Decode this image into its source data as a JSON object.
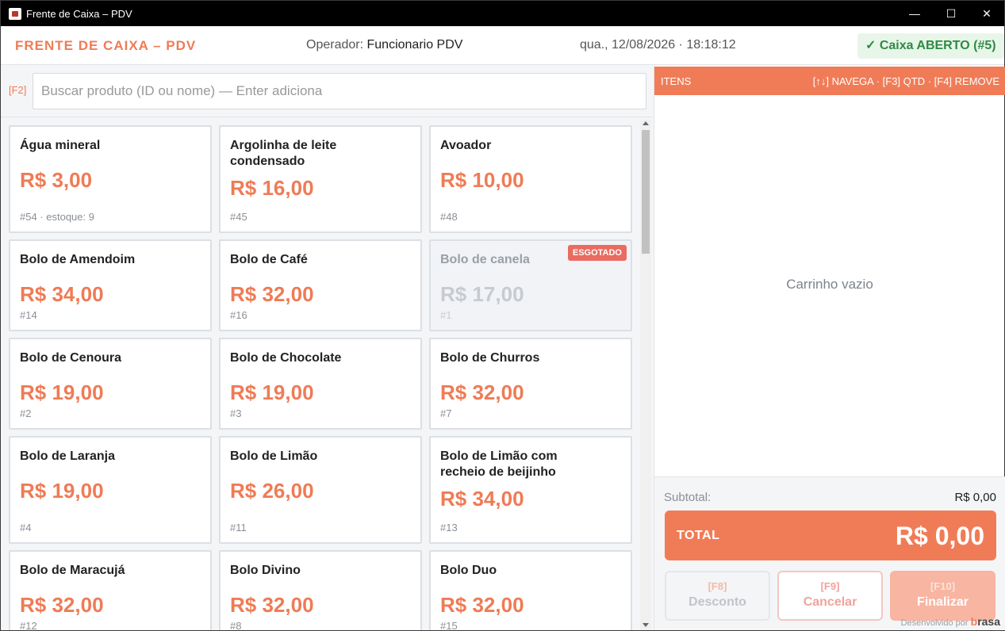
{
  "window": {
    "title": "Frente de Caixa – PDV",
    "controls": {
      "minimize": "—",
      "maximize": "☐",
      "close": "✕"
    }
  },
  "header": {
    "brand": "FRENTE DE CAIXA – PDV",
    "operator_label": "Operador:",
    "operator_name": "Funcionario PDV",
    "datetime": "qua., 12/08/2026 · 18:18:12",
    "status": "✓ Caixa ABERTO (#5)"
  },
  "search": {
    "hotkey": "[F2]",
    "placeholder": "Buscar produto (ID ou nome) — Enter adiciona",
    "value": ""
  },
  "products": [
    {
      "name": "Água mineral",
      "price": "R$ 3,00",
      "meta": "#54 · estoque: 9",
      "sold_out": false
    },
    {
      "name": "Argolinha de leite condensado",
      "price": "R$ 16,00",
      "meta": "#45",
      "sold_out": false
    },
    {
      "name": "Avoador",
      "price": "R$ 10,00",
      "meta": "#48",
      "sold_out": false
    },
    {
      "name": "Bolo de Amendoim",
      "price": "R$ 34,00",
      "meta": "#14",
      "sold_out": false
    },
    {
      "name": "Bolo de Café",
      "price": "R$ 32,00",
      "meta": "#16",
      "sold_out": false
    },
    {
      "name": "Bolo de canela",
      "price": "R$ 17,00",
      "meta": "#1",
      "sold_out": true,
      "badge": "ESGOTADO"
    },
    {
      "name": "Bolo de Cenoura",
      "price": "R$ 19,00",
      "meta": "#2",
      "sold_out": false
    },
    {
      "name": "Bolo de Chocolate",
      "price": "R$ 19,00",
      "meta": "#3",
      "sold_out": false
    },
    {
      "name": "Bolo de Churros",
      "price": "R$ 32,00",
      "meta": "#7",
      "sold_out": false
    },
    {
      "name": "Bolo de Laranja",
      "price": "R$ 19,00",
      "meta": "#4",
      "sold_out": false
    },
    {
      "name": "Bolo de Limão",
      "price": "R$ 26,00",
      "meta": "#11",
      "sold_out": false
    },
    {
      "name": "Bolo de Limão com recheio de beijinho",
      "price": "R$ 34,00",
      "meta": "#13",
      "sold_out": false
    },
    {
      "name": "Bolo de Maracujá",
      "price": "R$ 32,00",
      "meta": "#12",
      "sold_out": false
    },
    {
      "name": "Bolo Divino",
      "price": "R$ 32,00",
      "meta": "#8",
      "sold_out": false
    },
    {
      "name": "Bolo Duo",
      "price": "R$ 32,00",
      "meta": "#15",
      "sold_out": false
    }
  ],
  "cart": {
    "title": "ITENS",
    "hint": "[↑↓] NAVEGA · [F3] QTD · [F4] REMOVE",
    "empty_text": "Carrinho vazio",
    "subtotal_label": "Subtotal:",
    "subtotal_value": "R$ 0,00",
    "total_label": "TOTAL",
    "total_value": "R$ 0,00"
  },
  "actions": {
    "discount": {
      "key": "[F8]",
      "label": "Desconto"
    },
    "cancel": {
      "key": "[F9]",
      "label": "Cancelar"
    },
    "finalize": {
      "key": "[F10]",
      "label": "Finalizar"
    }
  },
  "footer": {
    "credit": "Desenvolvido por",
    "logo_prefix": "b",
    "logo_text": "rasa"
  },
  "colors": {
    "accent": "#f07c57",
    "success": "#2f8a43",
    "sold_out_badge": "#ea6b60"
  }
}
